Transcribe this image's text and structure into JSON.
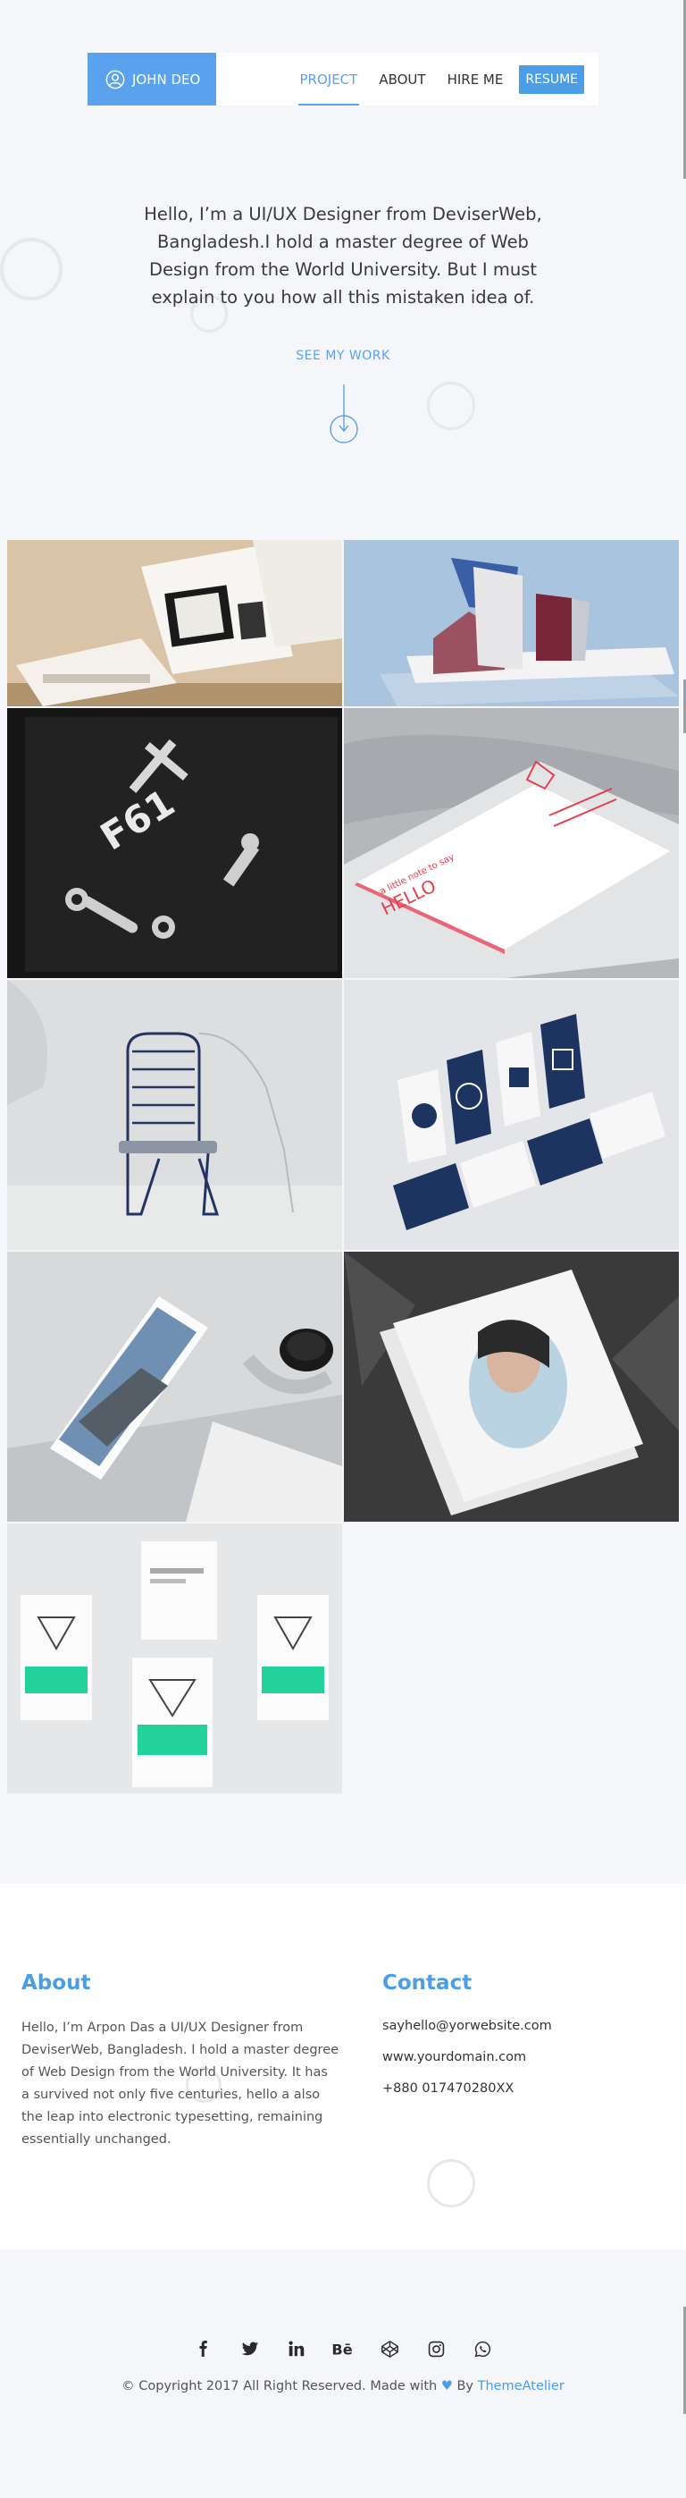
{
  "header": {
    "brand": "JOHN DEO",
    "nav": [
      {
        "label": "PROJECT",
        "active": true
      },
      {
        "label": "ABOUT",
        "active": false
      },
      {
        "label": "HIRE ME",
        "active": false
      }
    ],
    "resume": "RESUME",
    "accent": "#5aa1ee"
  },
  "hero": {
    "intro": "Hello, I’m a UI/UX Designer from DeviserWeb, Bangladesh.I hold a master degree of Web Design from the World University. But I must explain to you how all this mistaken idea of.",
    "cta": "SEE MY WORK",
    "scroll_icon": "arrow-down-circle-icon"
  },
  "gallery": {
    "items": [
      {
        "subject": "brochure mockup"
      },
      {
        "subject": "folded cards stand"
      },
      {
        "subject": "F61 tool brand"
      },
      {
        "subject": "letterpress card"
      },
      {
        "subject": "wire chair"
      },
      {
        "subject": "business card set"
      },
      {
        "subject": "photo print with coffee"
      },
      {
        "subject": "magazine stack"
      },
      {
        "subject": "coffee bags"
      }
    ],
    "text": {
      "f61": "F61",
      "card_hello": "HELLO",
      "card_small": "a little note to say"
    }
  },
  "about": {
    "title": "About",
    "text": "Hello, I’m Arpon Das a UI/UX Designer from DeviserWeb, Bangladesh. I hold a master degree of Web Design from the World University. It has a survived not only five centuries, hello a also the leap into electronic typesetting, remaining essentially unchanged."
  },
  "contact": {
    "title": "Contact",
    "email": "sayhello@yorwebsite.com",
    "website": "www.yourdomain.com",
    "phone": "+880 017470280XX"
  },
  "footer": {
    "socials": [
      "facebook-icon",
      "twitter-icon",
      "linkedin-icon",
      "behance-icon",
      "codepen-icon",
      "instagram-icon",
      "whatsapp-icon"
    ],
    "copyright_prefix": "© Copyright 2017 All Right Reserved. Made with",
    "copyright_by": "By",
    "copyright_brand": "ThemeAtelier"
  }
}
